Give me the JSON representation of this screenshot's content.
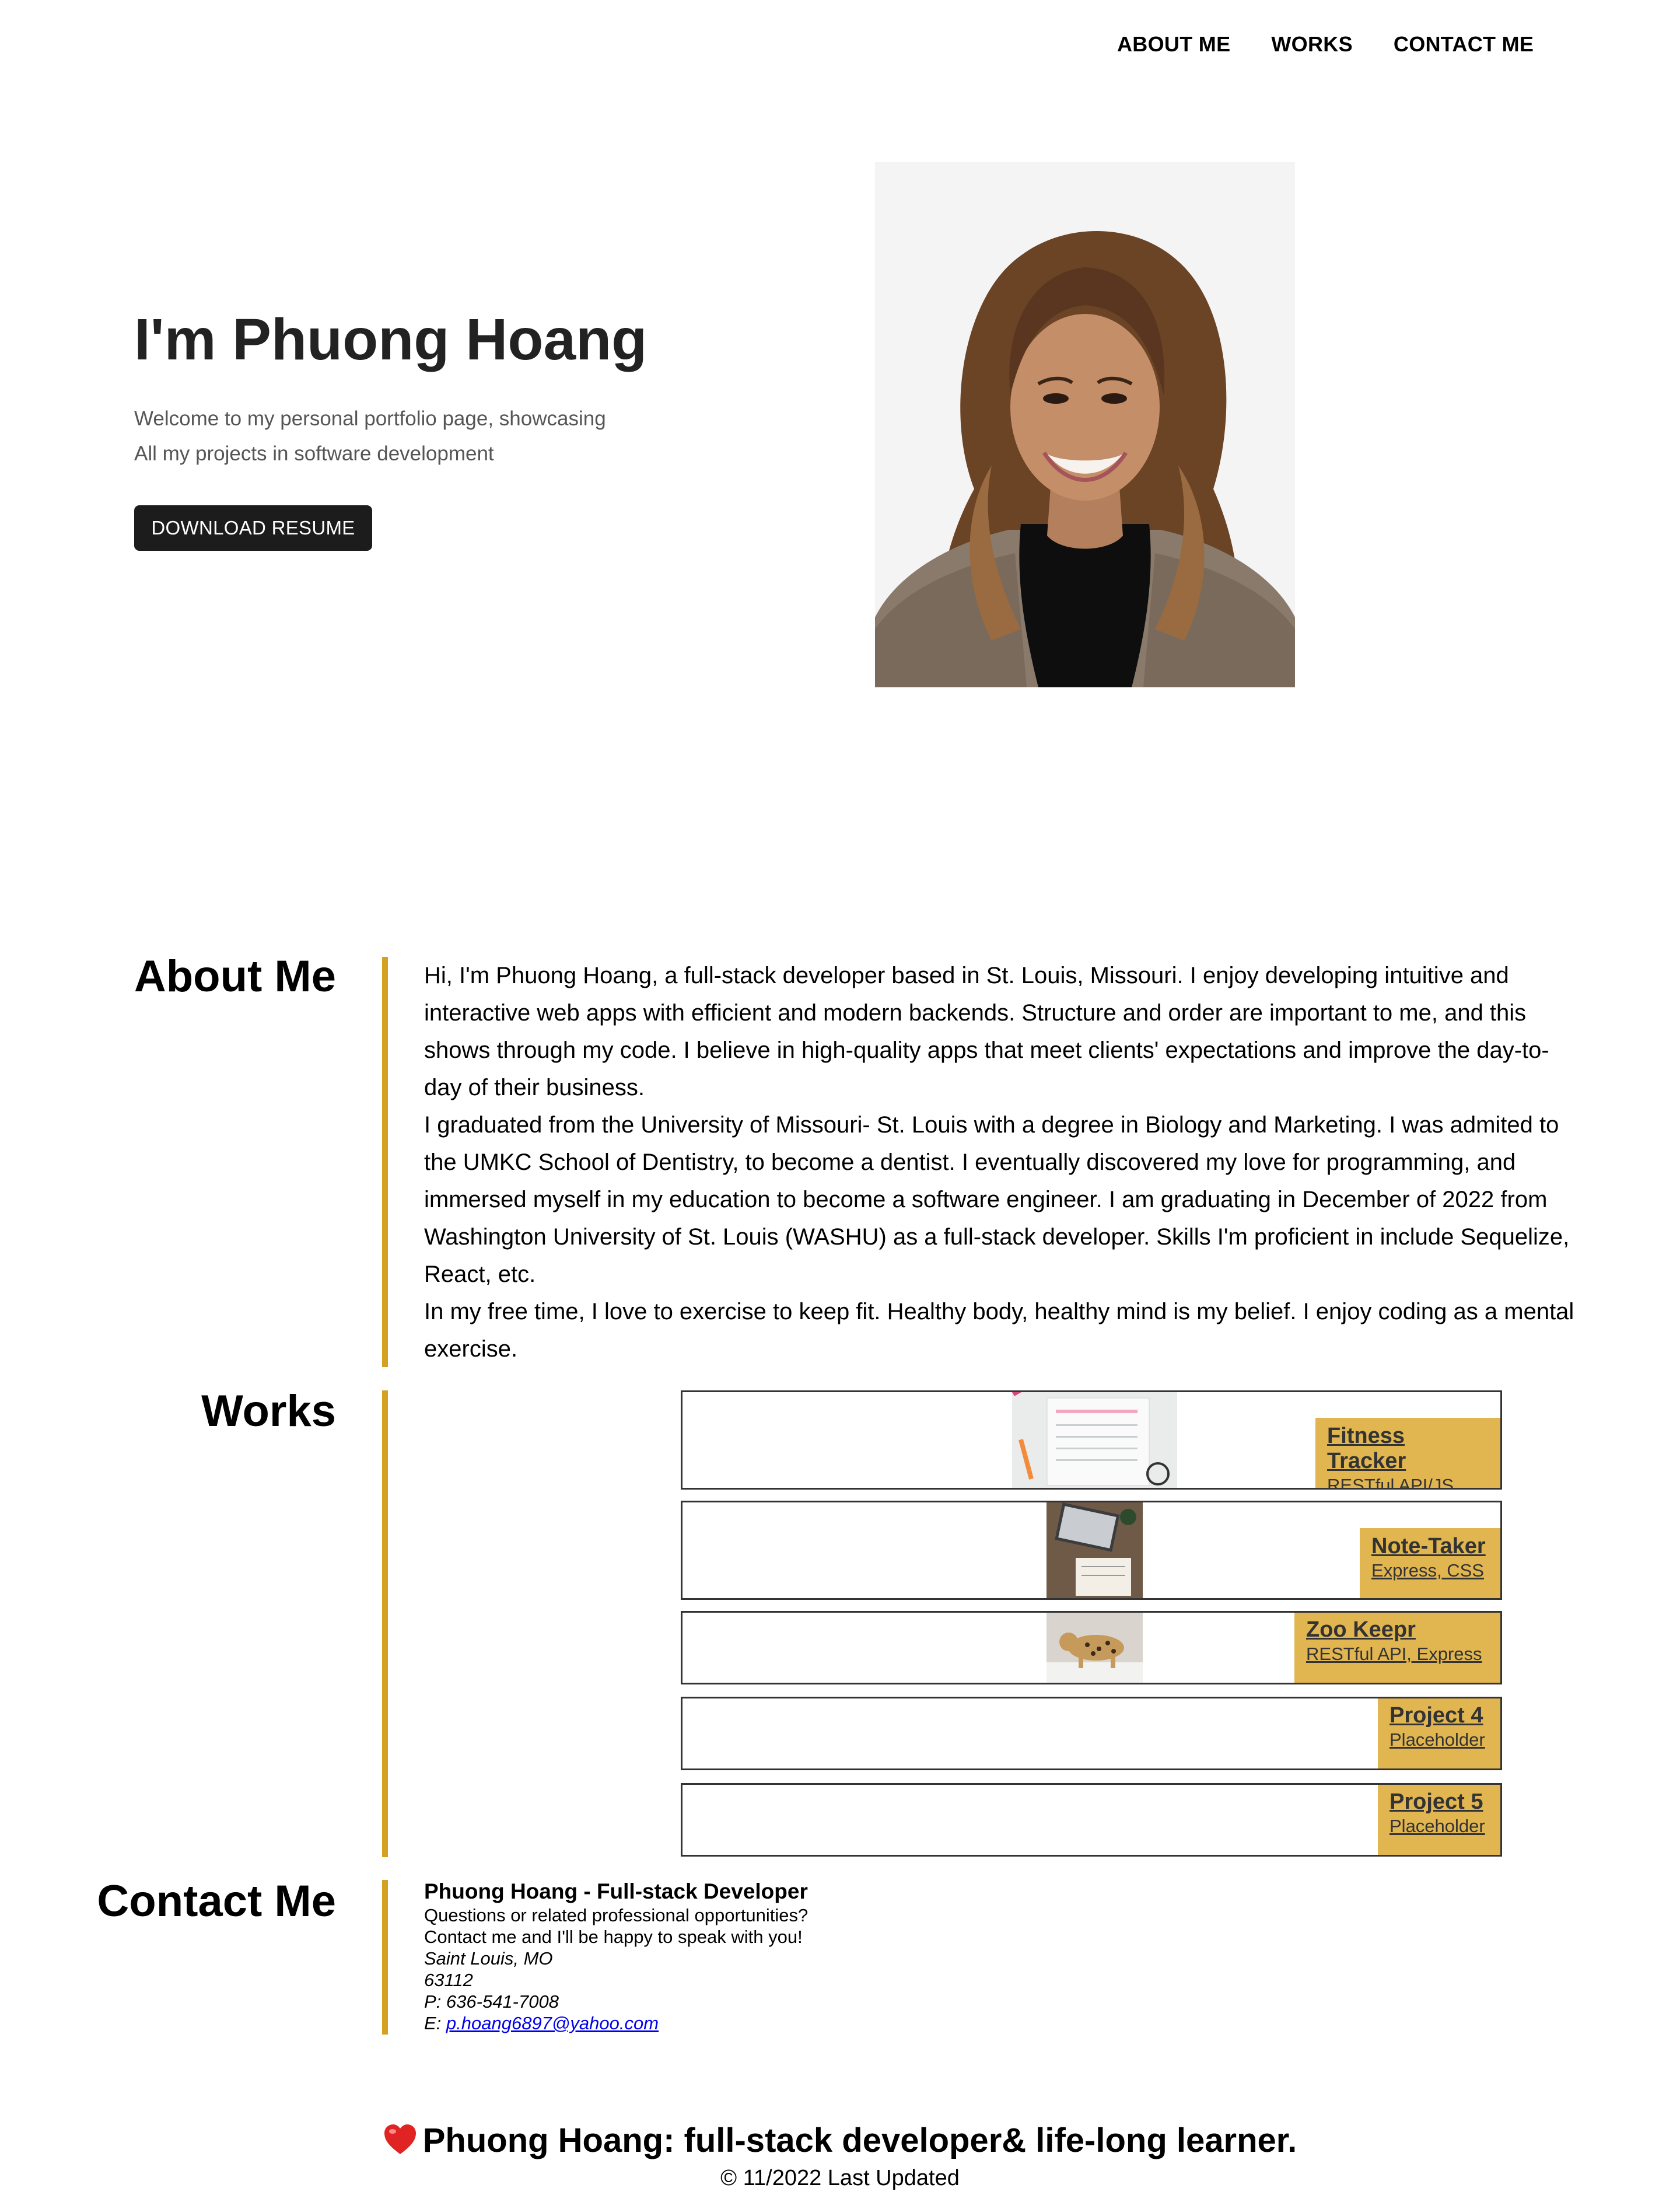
{
  "nav": {
    "items": [
      "ABOUT ME",
      "WORKS",
      "CONTACT ME"
    ]
  },
  "hero": {
    "title": "I'm Phuong Hoang",
    "subtitle_line1": "Welcome to my personal portfolio page, showcasing",
    "subtitle_line2": "All my projects in software development",
    "button_label": "DOWNLOAD RESUME"
  },
  "about": {
    "title": "About Me",
    "paragraphs": [
      "Hi, I'm Phuong Hoang, a full-stack developer based in St. Louis, Missouri. I enjoy developing intuitive and interactive web apps with efficient and modern backends. Structure and order are important to me, and this shows through my code. I believe in high-quality apps that meet clients' expectations and improve the day-to-day of their business.",
      "I graduated from the University of Missouri- St. Louis with a degree in Biology and Marketing. I was admited to the UMKC School of Dentistry, to become a dentist. I eventually discovered my love for programming, and immersed myself in my education to become a software engineer. I am graduating in December of 2022 from Washington University of St. Louis (WASHU) as a full-stack developer. Skills I'm proficient in include Sequelize, React, etc.",
      "In my free time, I love to exercise to keep fit. Healthy body, healthy mind is my belief. I enjoy coding as a mental exercise."
    ]
  },
  "works": {
    "title": "Works",
    "projects": [
      {
        "title": "Fitness Tracker",
        "subtitle": "RESTful API/JS"
      },
      {
        "title": "Note-Taker",
        "subtitle": "Express, CSS"
      },
      {
        "title": "Zoo Keepr",
        "subtitle": "RESTful API, Express"
      },
      {
        "title": "Project 4",
        "subtitle": "Placeholder"
      },
      {
        "title": "Project 5",
        "subtitle": "Placeholder"
      }
    ]
  },
  "contact": {
    "title": "Contact Me",
    "name": "Phuong Hoang - Full-stack Developer",
    "line1": "Questions or related professional opportunities?",
    "line2": "Contact me and I'll be happy to speak with you!",
    "city": "Saint Louis, MO",
    "zip": "63112",
    "phone": "P: 636-541-7008",
    "email_prefix": "E: ",
    "email": "p.hoang6897@yahoo.com"
  },
  "footer": {
    "title": "Phuong Hoang: full-stack developer& life-long learner.",
    "updated": "© 11/2022 Last Updated"
  },
  "colors": {
    "accent_bar": "#d4a122",
    "label_bg": "#e1b550",
    "button_bg": "#1c1c1c"
  }
}
